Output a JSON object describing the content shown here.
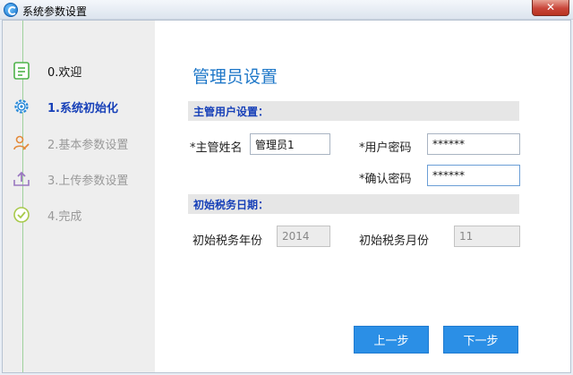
{
  "window": {
    "title": "系统参数设置",
    "close_glyph": "✕"
  },
  "steps": [
    {
      "label": "0.欢迎",
      "icon": "welcome-icon",
      "state": "done"
    },
    {
      "label": "1.系统初始化",
      "icon": "gear-icon",
      "state": "active"
    },
    {
      "label": "2.基本参数设置",
      "icon": "user-edit-icon",
      "state": "todo"
    },
    {
      "label": "3.上传参数设置",
      "icon": "upload-icon",
      "state": "todo"
    },
    {
      "label": "4.完成",
      "icon": "check-icon",
      "state": "todo"
    }
  ],
  "main": {
    "title": "管理员设置",
    "admin_section": "主管用户设置：",
    "admin_name_label": "*主管姓名",
    "admin_name_value": "管理员1",
    "password_label": "*用户密码",
    "password_value": "******",
    "confirm_label": "*确认密码",
    "confirm_value": "******",
    "tax_section": "初始税务日期：",
    "tax_year_label": "初始税务年份",
    "tax_year_value": "2014",
    "tax_month_label": "初始税务月份",
    "tax_month_value": "11"
  },
  "buttons": {
    "prev": "上一步",
    "next": "下一步"
  },
  "colors": {
    "accent": "#2b8fe6",
    "active_step": "#1740b8",
    "step_line": "#9fd19b",
    "title": "#1e77c8"
  }
}
